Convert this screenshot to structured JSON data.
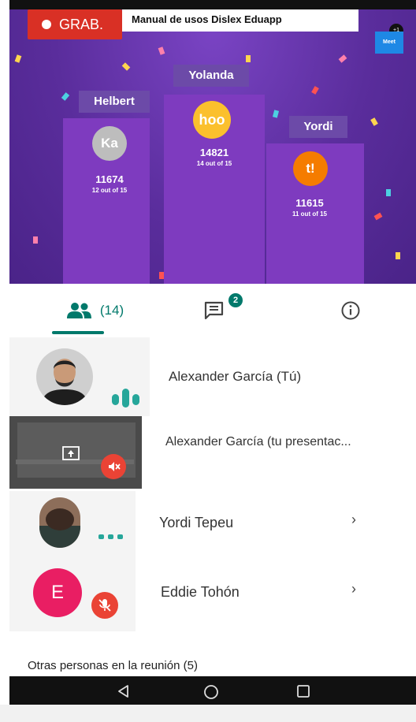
{
  "recording": {
    "label": "GRAB."
  },
  "document": {
    "title": "Manual de usos Dislex Eduapp"
  },
  "corner_badge": {
    "label": "Meet",
    "count": "+1"
  },
  "podium": [
    {
      "name": "Helbert",
      "avatar_text": "Ka",
      "score": "11674",
      "correct": "12 out of 15"
    },
    {
      "name": "Yolanda",
      "avatar_text": "hoo",
      "score": "14821",
      "correct": "14 out of 15"
    },
    {
      "name": "Yordi",
      "avatar_text": "t!",
      "score": "11615",
      "correct": "11 out of 15"
    }
  ],
  "tabs": {
    "people_count": "(14)",
    "chat_badge": "2"
  },
  "participants": [
    {
      "name": "Alexander García (Tú)"
    },
    {
      "name": "Alexander García (tu presentac..."
    },
    {
      "name": "Yordi Tepeu"
    },
    {
      "name": "Eddie Tohón",
      "avatar_letter": "E"
    }
  ],
  "others_label": "Otras personas en la reunión (5)",
  "colors": {
    "accent": "#00796b",
    "mute": "#ea4335",
    "podium_bg": "#5a2d9c"
  }
}
